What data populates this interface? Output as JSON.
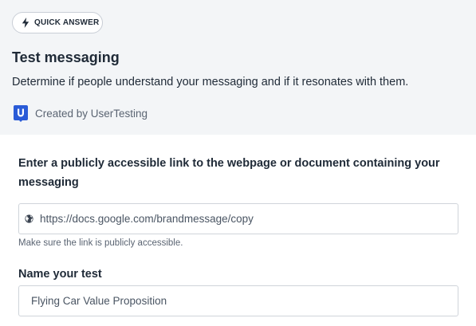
{
  "badge": {
    "label": "QUICK ANSWER",
    "icon": "lightning-icon"
  },
  "template": {
    "title": "Test messaging",
    "description": "Determine if people understand your messaging and if it resonates with them.",
    "creator": "Created by UserTesting",
    "creator_logo": "usertesting-logo"
  },
  "form": {
    "link_label": "Enter a publicly accessible link to the webpage or document containing your messaging",
    "link_value": "https://docs.google.com/brandmessage/copy",
    "link_icon": "globe-icon",
    "link_hint": "Make sure the link is publicly accessible.",
    "name_label": "Name your test",
    "name_value": "Flying Car Value Proposition"
  },
  "colors": {
    "header_bg": "#f3f5f7",
    "brand_blue": "#2a5bd7",
    "text_dark": "#1f2a37",
    "text_muted": "#5a6472"
  }
}
